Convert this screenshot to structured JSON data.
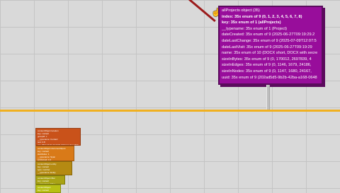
{
  "panel": {
    "title": "allProjects object (35)",
    "rows": [
      {
        "text": "index:  35x enum of 9 (0, 1, 2, 3, 4, 5, 6, 7, 8)",
        "strong": true
      },
      {
        "text": "key:  35x enum of 1 (allProjects)",
        "strong": true
      },
      {
        "text": "__typename:  35x enum of 1 (Project)",
        "strong": false
      },
      {
        "text": "dateCreated:  35x enum of 9 (2025-06-27T09:19:29.2",
        "strong": false
      },
      {
        "text": "dateLastChange:  35x enum of 9 (2025-07-09T12:07:5",
        "strong": false
      },
      {
        "text": "dateLastVisit:  35x enum of 9 (2025-06-27T09:19:29",
        "strong": false
      },
      {
        "text": "name:  35x enum of 10 (DOCX short, DOCX with secre",
        "strong": false
      },
      {
        "text": "sizeInBytes:  35x enum of 9 (0, 170012, 2697839, 4",
        "strong": false
      },
      {
        "text": "sizeInEdges:  35x enum of 9 (0, 1146, 1679, 24186,",
        "strong": false
      },
      {
        "text": "sizeInNodes:  35x enum of 9 (0, 1147, 1680, 24167,",
        "strong": false
      },
      {
        "text": "uuid:  35x enum of 9 (202ad5d5-9b2b-42ba-a168-0648",
        "strong": false
      }
    ]
  },
  "cursor_icon": "pointer-hand-icon",
  "colors": {
    "panel_bg": "#980d9b",
    "split_line": "#f0b020",
    "node_colors": [
      "#c9521a",
      "#d97a18",
      "#b58a12",
      "#a9a315",
      "#b8c014"
    ]
  },
  "nodes": [
    {
      "lines": [
        "contentObject.location",
        "key: contact",
        "groupId: x",
        "__typename: Contact",
        "text: 4.8",
        "nid: 7B03 7F7F 00 0007 0033 DaoTypeB7F7F ..."
      ]
    },
    {
      "lines": [
        "contentObject.documentSpan",
        "key: contact",
        "startIndex: 1",
        "__typename: Span",
        "entityUuid: 1:0",
        "nid: 7B03 7F7F 00 0007 ..."
      ]
    },
    {
      "lines": [
        "contentObject.entity",
        "key: contact",
        "type: number",
        "__typename: Entity",
        "entity: 1",
        "entityIndex: ..."
      ]
    },
    {
      "lines": [
        "contentObject.filter",
        "key: contact",
        "__typename: Filter",
        "..."
      ]
    },
    {
      "lines": [
        "contentObject",
        "key: contact",
        "..."
      ]
    }
  ]
}
